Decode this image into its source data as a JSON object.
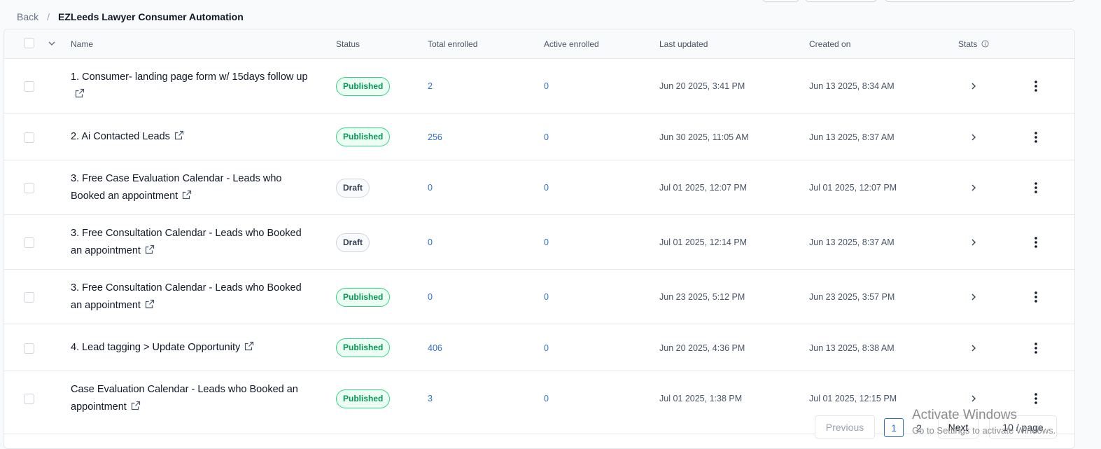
{
  "breadcrumb": {
    "back": "Back",
    "separator": "/",
    "title": "EZLeeds Lawyer Consumer Automation"
  },
  "table": {
    "headers": {
      "name": "Name",
      "status": "Status",
      "total_enrolled": "Total enrolled",
      "active_enrolled": "Active enrolled",
      "last_updated": "Last updated",
      "created_on": "Created on",
      "stats": "Stats"
    },
    "rows": [
      {
        "name": "1. Consumer- landing page form w/ 15days follow up",
        "status": "Published",
        "total": "2",
        "active": "0",
        "updated": "Jun 20 2025, 3:41 PM",
        "created": "Jun 13 2025, 8:34 AM"
      },
      {
        "name": "2. Ai Contacted Leads",
        "status": "Published",
        "total": "256",
        "active": "0",
        "updated": "Jun 30 2025, 11:05 AM",
        "created": "Jun 13 2025, 8:37 AM"
      },
      {
        "name": "3. Free Case Evaluation Calendar - Leads who Booked an appointment",
        "status": "Draft",
        "total": "0",
        "active": "0",
        "updated": "Jul 01 2025, 12:07 PM",
        "created": "Jul 01 2025, 12:07 PM"
      },
      {
        "name": "3. Free Consultation Calendar - Leads who Booked an appointment",
        "status": "Draft",
        "total": "0",
        "active": "0",
        "updated": "Jul 01 2025, 12:14 PM",
        "created": "Jun 13 2025, 8:37 AM"
      },
      {
        "name": "3. Free Consultation Calendar - Leads who Booked an appointment",
        "status": "Published",
        "total": "0",
        "active": "0",
        "updated": "Jun 23 2025, 5:12 PM",
        "created": "Jun 23 2025, 3:57 PM"
      },
      {
        "name": "4. Lead tagging > Update Opportunity",
        "status": "Published",
        "total": "406",
        "active": "0",
        "updated": "Jun 20 2025, 4:36 PM",
        "created": "Jun 13 2025, 8:38 AM"
      },
      {
        "name": "Case Evaluation Calendar - Leads who Booked an appointment",
        "status": "Published",
        "total": "3",
        "active": "0",
        "updated": "Jul 01 2025, 1:38 PM",
        "created": "Jul 01 2025, 12:15 PM"
      }
    ]
  },
  "pagination": {
    "previous": "Previous",
    "page1": "1",
    "page2": "2",
    "next": "Next",
    "per_page": "10 / page"
  },
  "watermark": {
    "line1": "Activate Windows",
    "line2": "Go to Settings to activate Windows."
  },
  "colors": {
    "published": "#039855",
    "link": "#2e6fd9",
    "border": "#e4e7ec"
  }
}
